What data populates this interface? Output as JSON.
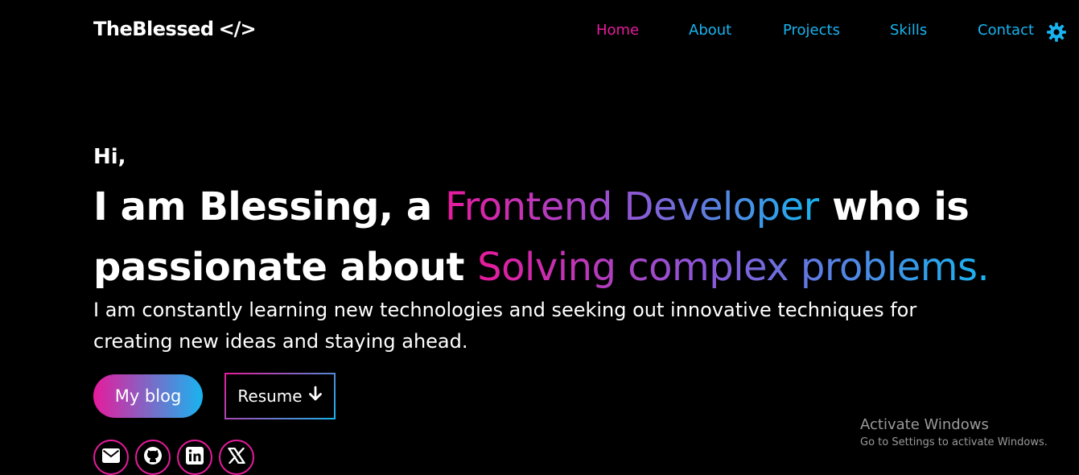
{
  "header": {
    "logo_text": "TheBlessed",
    "logo_icon": "</>",
    "nav": [
      {
        "label": "Home",
        "active": true
      },
      {
        "label": "About",
        "active": false
      },
      {
        "label": "Projects",
        "active": false
      },
      {
        "label": "Skills",
        "active": false
      },
      {
        "label": "Contact",
        "active": false
      }
    ],
    "settings_icon": "gear-icon"
  },
  "hero": {
    "greeting": "Hi,",
    "headline": {
      "line1_pre": "I am Blessing, a ",
      "line1_highlight": "Frontend Developer",
      "line1_post": " who is",
      "line2_pre": "passionate about ",
      "line2_highlight": "Solving complex problems."
    },
    "subtitle": "I am constantly learning new technologies and seeking out innovative techniques for creating new ideas and staying ahead.",
    "blog_button": "My blog",
    "resume_button": "Resume",
    "resume_icon": "arrow-down-icon"
  },
  "social": [
    "envelope-icon",
    "github-icon",
    "linkedin-icon",
    "x-icon"
  ],
  "watermark": {
    "title": "Activate Windows",
    "subtitle": "Go to Settings to activate Windows."
  },
  "colors": {
    "accent_pink": "#e61b9c",
    "accent_blue": "#18b4f0",
    "background": "#000000"
  }
}
